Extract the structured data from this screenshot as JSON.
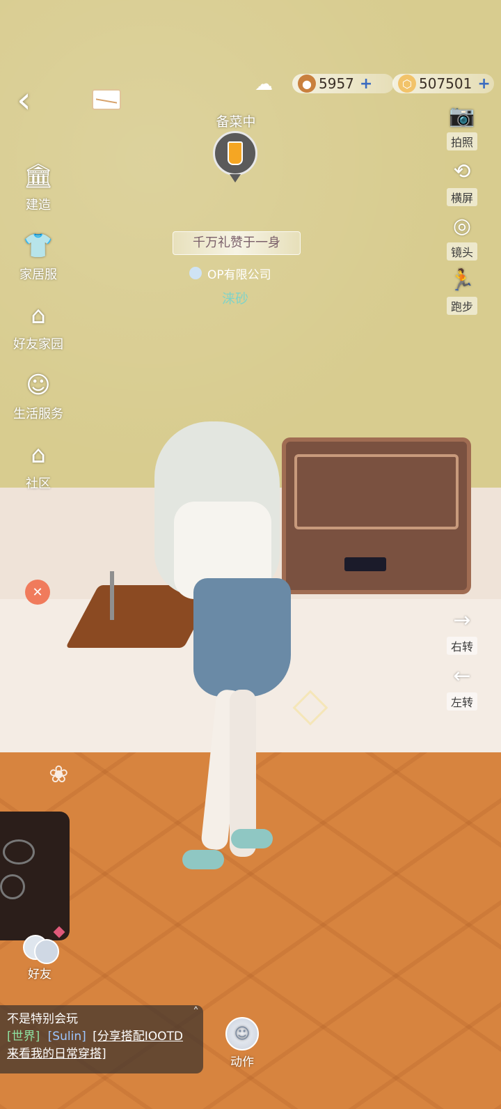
{
  "currency": {
    "acorn": {
      "value": "5957",
      "icon": "acorn-icon"
    },
    "gem": {
      "value": "507501",
      "icon": "gem-coin-icon"
    }
  },
  "status": {
    "label": "备菜中"
  },
  "name_tag": {
    "title": "千万礼赞于一身",
    "guild": "OP有限公司",
    "player": "涞砂"
  },
  "left_menu": [
    {
      "label": "建造",
      "icon": "building-icon"
    },
    {
      "label": "家居服",
      "icon": "home-clothes-icon"
    },
    {
      "label": "好友家园",
      "icon": "friend-home-icon"
    },
    {
      "label": "生活服务",
      "icon": "life-service-icon"
    },
    {
      "label": "社区",
      "icon": "community-icon"
    }
  ],
  "right_menu": [
    {
      "label": "拍照",
      "icon": "camera-icon"
    },
    {
      "label": "横屏",
      "icon": "rotate-screen-icon"
    },
    {
      "label": "镜头",
      "icon": "lens-icon"
    },
    {
      "label": "跑步",
      "icon": "run-icon"
    }
  ],
  "rotate": {
    "right": "右转",
    "left": "左转"
  },
  "bottom": {
    "friends": "好友",
    "action": "动作"
  },
  "chat": {
    "line1": "不是特别会玩",
    "channel": "[世界]",
    "user": "[Sulin]",
    "link_part1": "[分享搭配IOOTD",
    "link_part2": "来看我的日常穿搭]"
  },
  "colors": {
    "accent_blue": "#3b6cc0",
    "player_name": "#7fd3c8"
  }
}
